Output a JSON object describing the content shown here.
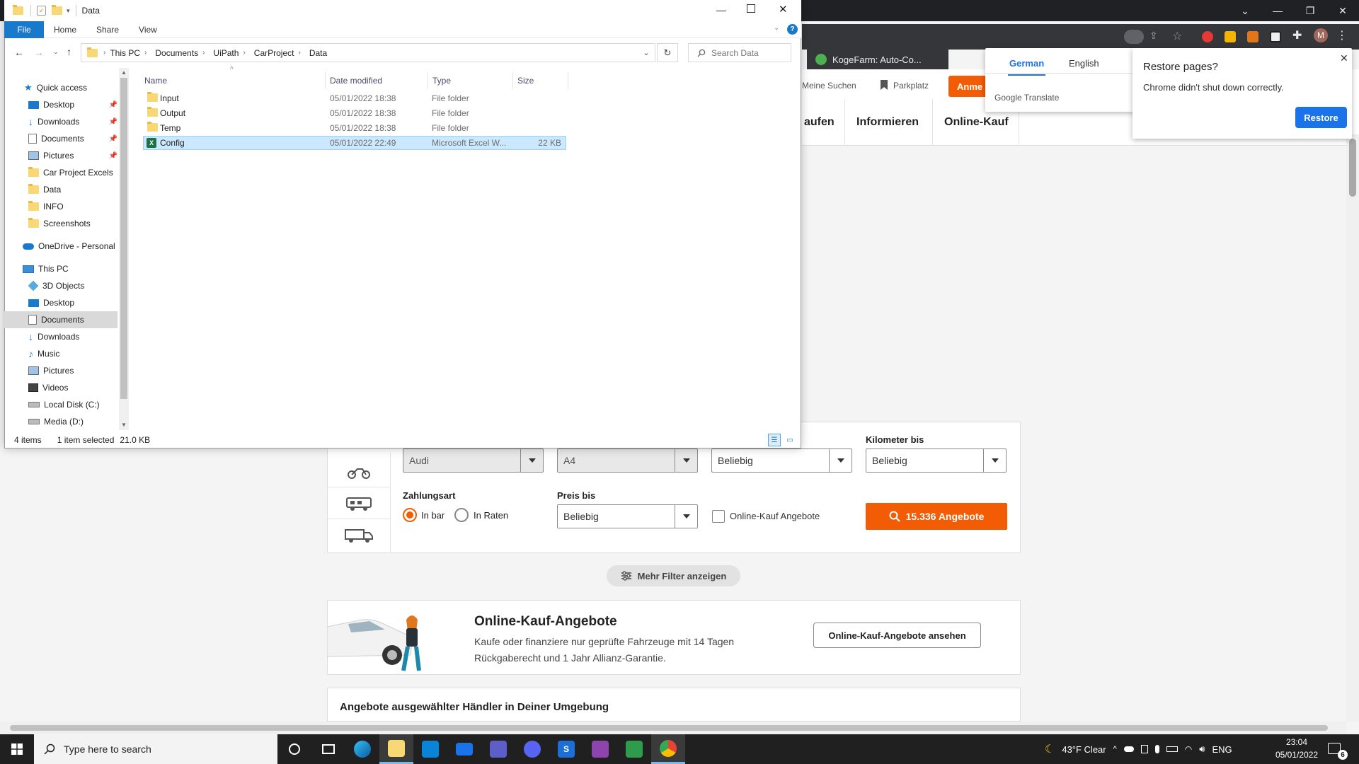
{
  "explorer": {
    "title": "Data",
    "ribbon_tabs": [
      "File",
      "Home",
      "Share",
      "View"
    ],
    "breadcrumb": [
      "This PC",
      "Documents",
      "UiPath",
      "CarProject",
      "Data"
    ],
    "search_placeholder": "Search Data",
    "nav": {
      "quick_access": "Quick access",
      "quick_items": [
        "Desktop",
        "Downloads",
        "Documents",
        "Pictures",
        "Car Project Excels",
        "Data",
        "INFO",
        "Screenshots"
      ],
      "onedrive": "OneDrive - Personal",
      "this_pc": "This PC",
      "pc_items": [
        "3D Objects",
        "Desktop",
        "Documents",
        "Downloads",
        "Music",
        "Pictures",
        "Videos",
        "Local Disk (C:)",
        "Media (D:)"
      ]
    },
    "columns": {
      "name": "Name",
      "date": "Date modified",
      "type": "Type",
      "size": "Size"
    },
    "files": [
      {
        "name": "Input",
        "date": "05/01/2022 18:38",
        "type": "File folder",
        "size": ""
      },
      {
        "name": "Output",
        "date": "05/01/2022 18:38",
        "type": "File folder",
        "size": ""
      },
      {
        "name": "Temp",
        "date": "05/01/2022 18:38",
        "type": "File folder",
        "size": ""
      },
      {
        "name": "Config",
        "date": "05/01/2022 22:49",
        "type": "Microsoft Excel W...",
        "size": "22 KB"
      }
    ],
    "status": {
      "count": "4 items",
      "selected": "1 item selected",
      "size": "21.0 KB"
    }
  },
  "chrome": {
    "tab_title": "KogeFarm: Auto-Co...",
    "bookmarks": [
      "Meine Suchen",
      "Parkplatz"
    ],
    "login_label": "Anme",
    "nav_items": [
      "aufen",
      "Informieren",
      "Online-Kauf"
    ]
  },
  "translate": {
    "lang_from": "German",
    "lang_to": "English",
    "brand": "Google Translate"
  },
  "restore": {
    "title": "Restore pages?",
    "message": "Chrome didn't shut down correctly.",
    "button": "Restore"
  },
  "search_form": {
    "make": "Audi",
    "model": "A4",
    "price_from": "Beliebig",
    "km_label": "Kilometer bis",
    "km_value": "Beliebig",
    "payment_label": "Zahlungsart",
    "pay_cash": "In bar",
    "pay_rates": "In Raten",
    "price_label": "Preis bis",
    "price_value": "Beliebig",
    "online_checkbox": "Online-Kauf Angebote",
    "offers_button": "15.336 Angebote",
    "more_filters": "Mehr Filter anzeigen"
  },
  "online_card": {
    "title": "Online-Kauf-Angebote",
    "text": "Kaufe oder finanziere nur geprüfte Fahrzeuge mit 14 Tagen Rückgaberecht und 1 Jahr Allianz-Garantie.",
    "button": "Online-Kauf-Angebote ansehen"
  },
  "dealer_title": "Angebote ausgewählter Händler in Deiner Umgebung",
  "taskbar": {
    "search_placeholder": "Type here to search",
    "weather": "43°F  Clear",
    "lang": "ENG",
    "time": "23:04",
    "date": "05/01/2022",
    "notif_count": "6"
  },
  "colors": {
    "accent_orange": "#f25c05",
    "win_blue": "#1979ca",
    "chrome_blue": "#1a73e8"
  }
}
